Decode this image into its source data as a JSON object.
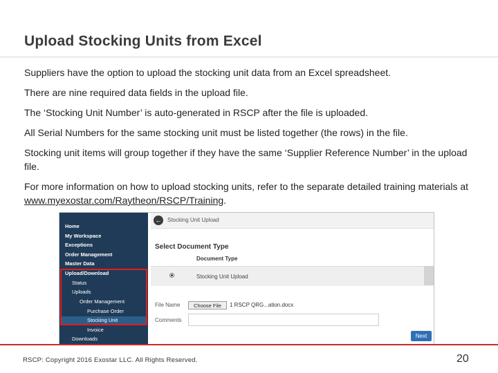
{
  "slide": {
    "title": "Upload Stocking Units from Excel",
    "paragraphs": [
      "Suppliers have the option to upload the stocking unit data from an Excel spreadsheet.",
      "There are nine required data fields in the upload file.",
      "The ‘Stocking Unit Number’ is auto-generated in RSCP after the file is uploaded.",
      "All Serial Numbers for the same stocking unit must be listed together (the rows) in the file.",
      "Stocking unit items will group together if they have the same ‘Supplier Reference Number’ in the upload file."
    ],
    "more_info_prefix": "For more information on how to upload stocking units, refer to the separate detailed training materials at ",
    "more_info_link": "www.myexostar.com/Raytheon/RSCP/Training",
    "more_info_suffix": "."
  },
  "screenshot": {
    "sidebar": {
      "items": [
        {
          "label": "Home"
        },
        {
          "label": "My Workspace"
        },
        {
          "label": "Exceptions"
        },
        {
          "label": "Order Management"
        },
        {
          "label": "Master Data"
        },
        {
          "label": "Upload/Download"
        },
        {
          "label": "Status"
        },
        {
          "label": "Uploads"
        },
        {
          "label": "Order Management"
        },
        {
          "label": "Purchase Order"
        },
        {
          "label": "Stocking Unit"
        },
        {
          "label": "Invoice"
        },
        {
          "label": "Downloads"
        }
      ]
    },
    "main": {
      "topbar_label": "Stocking Unit Upload",
      "back_icon": "←",
      "section_title": "Select Document Type",
      "column_header": "Document Type",
      "row_label": "Stocking Unit Upload",
      "file_name_label": "File Name",
      "choose_file_label": "Choose File",
      "chosen_file": "1 RSCP QRG...ation.docx",
      "comments_label": "Comments",
      "next_label": "Next"
    }
  },
  "footer": {
    "copyright": "RSCP: Copyright 2016 Exostar LLC. All Rights Reserved.",
    "page_number": "20"
  },
  "colors": {
    "sidebar_bg": "#1f3b57",
    "highlight_box": "#e31c1c",
    "footer_line": "#cc2a2a",
    "next_button": "#2f6fb4"
  }
}
